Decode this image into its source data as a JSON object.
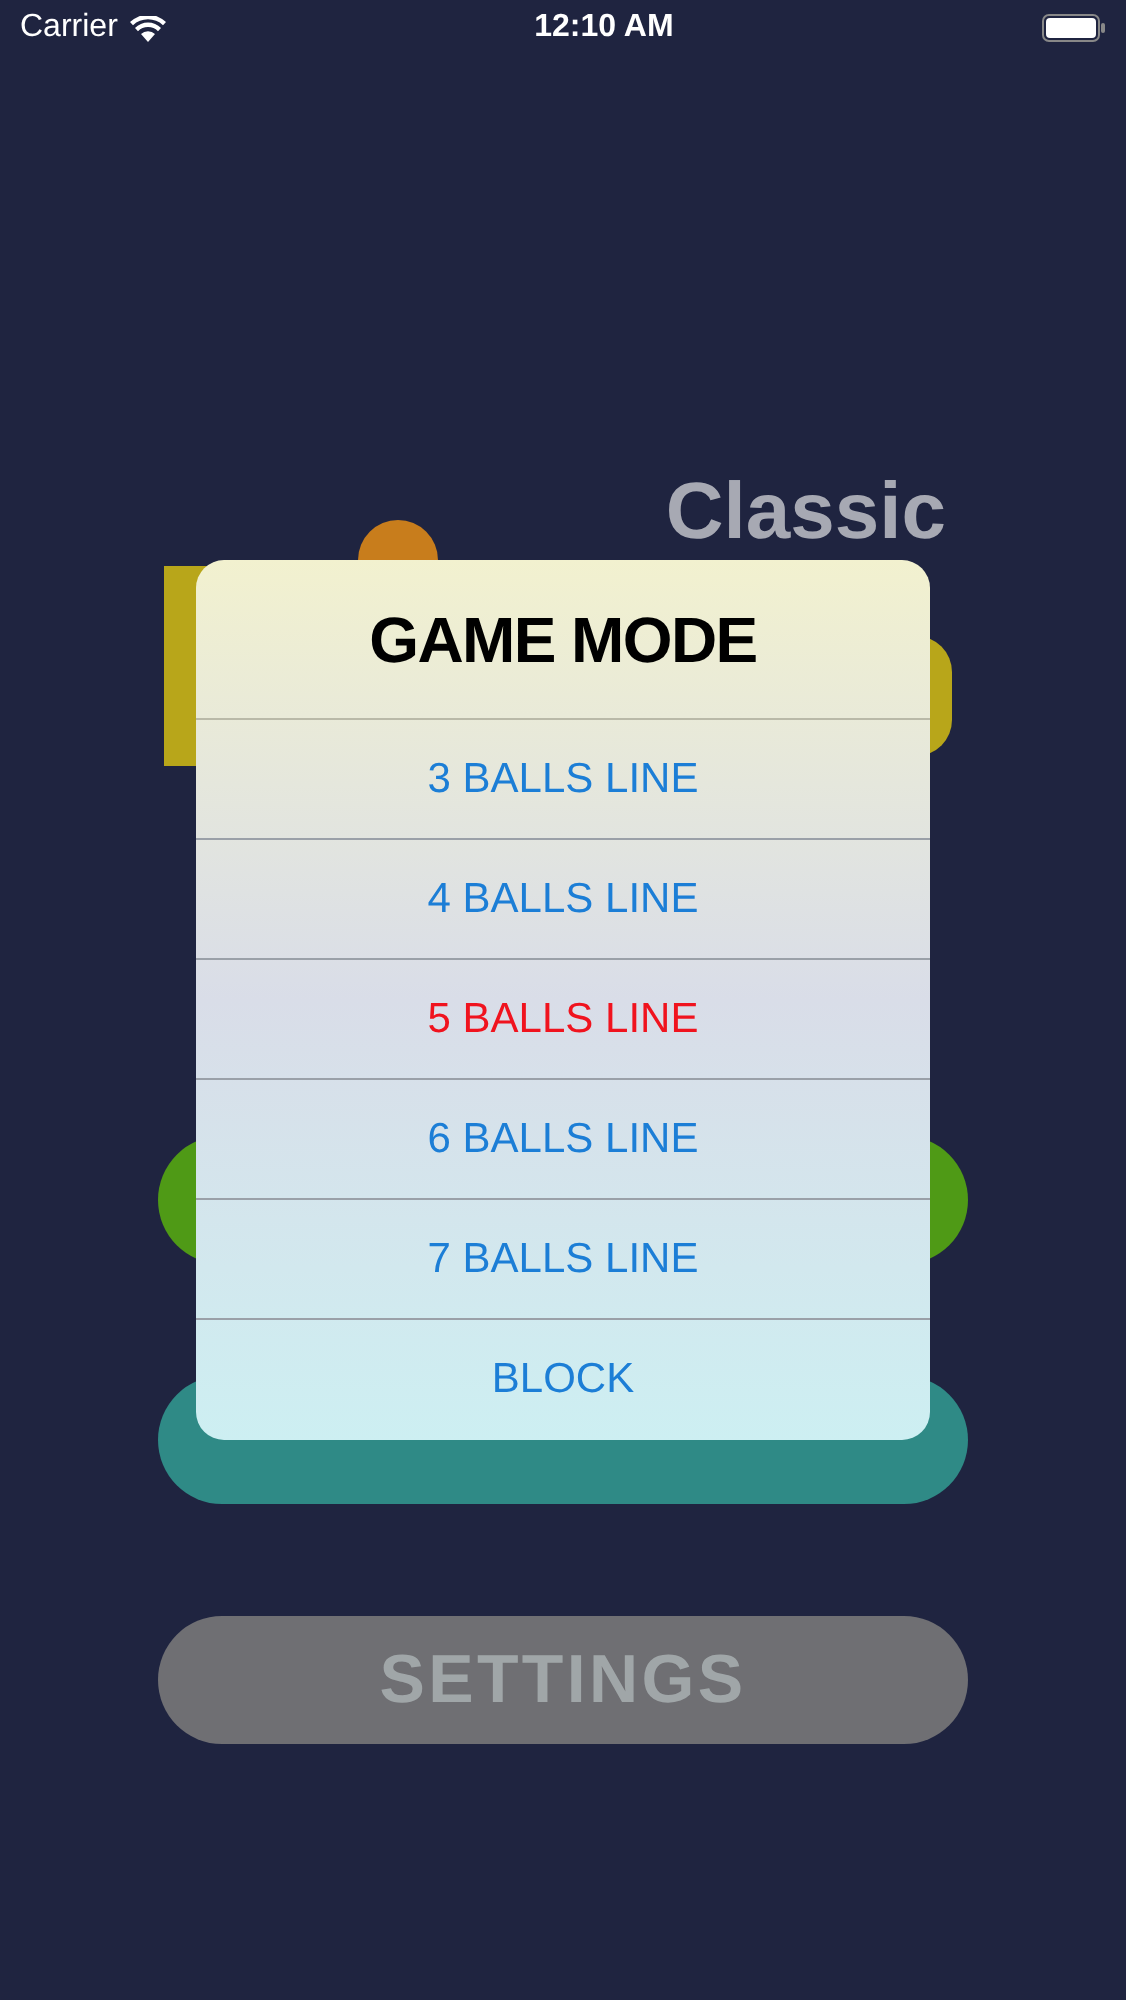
{
  "status_bar": {
    "carrier": "Carrier",
    "time": "12:10 AM"
  },
  "logo": {
    "subtitle": "Classic"
  },
  "menu_buttons": [
    {
      "kind": "play"
    },
    {
      "kind": "time"
    },
    {
      "kind": "settings",
      "label": "SETTINGS"
    }
  ],
  "dialog": {
    "title": "GAME MODE",
    "options": [
      {
        "label": "3 BALLS LINE",
        "selected": false
      },
      {
        "label": "4 BALLS LINE",
        "selected": false
      },
      {
        "label": "5 BALLS LINE",
        "selected": true
      },
      {
        "label": "6 BALLS LINE",
        "selected": false
      },
      {
        "label": "7 BALLS LINE",
        "selected": false
      },
      {
        "label": "BLOCK",
        "selected": false
      }
    ]
  }
}
